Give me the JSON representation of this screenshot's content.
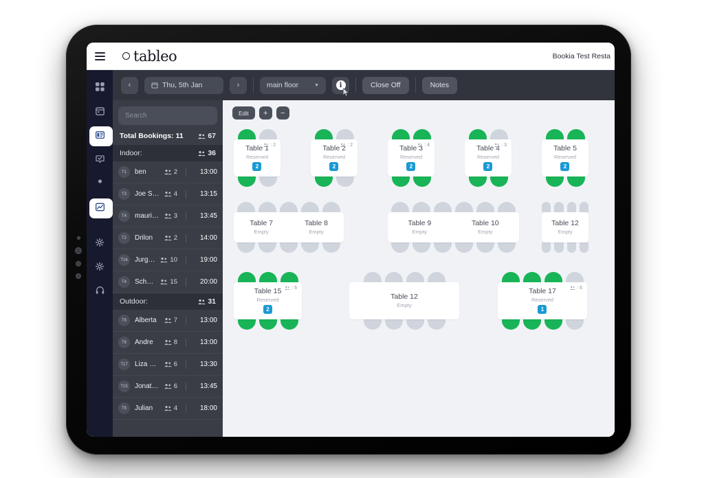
{
  "app": {
    "brand": "tableo",
    "restaurant": "Bookia Test Resta"
  },
  "rail": {
    "items": [
      {
        "icon": "dashboard-grid-icon",
        "active": false
      },
      {
        "icon": "calendar-icon",
        "active": false
      },
      {
        "icon": "table-layout-icon",
        "active": true
      },
      {
        "icon": "chat-bubble-icon",
        "active": false
      },
      {
        "icon": "person-icon",
        "active": false
      },
      {
        "icon": "chart-icon",
        "active": true
      },
      {
        "icon": "gear-icon",
        "active": false
      },
      {
        "icon": "gear-icon",
        "active": false
      },
      {
        "icon": "headset-icon",
        "active": false
      }
    ]
  },
  "toolbar": {
    "prev_label": "‹",
    "next_label": "›",
    "date": "Thu, 5th Jan",
    "floor": "main floor",
    "info_label": "i",
    "close_off": "Close Off",
    "notes": "Notes"
  },
  "sidebar": {
    "search_placeholder": "Search",
    "total_label": "Total Bookings: 11",
    "total_covers": "67",
    "groups": [
      {
        "label": "Indoor:",
        "covers": "36",
        "rows": [
          {
            "table": "T1",
            "name": "ben",
            "pax": "2",
            "time": "13:00",
            "stacked": false
          },
          {
            "table": "T3",
            "name": "Joe Sammut",
            "pax": "4",
            "time": "13:15",
            "stacked": false
          },
          {
            "table": "T4",
            "name": "mauricio suarez ...",
            "pax": "3",
            "time": "13:45",
            "stacked": false
          },
          {
            "table": "T2",
            "name": "Drilon",
            "pax": "2",
            "time": "14:00",
            "stacked": false
          },
          {
            "table": "T16",
            "name": "Jurgen",
            "pax": "10",
            "time": "19:00",
            "stacked": false
          },
          {
            "table": "T4",
            "name": "Schembri",
            "pax": "15",
            "time": "20:00",
            "stacked": true
          }
        ]
      },
      {
        "label": "Outdoor:",
        "covers": "31",
        "rows": [
          {
            "table": "T5",
            "name": "Alberta",
            "pax": "7",
            "time": "13:00",
            "stacked": false
          },
          {
            "table": "T6",
            "name": "Andre",
            "pax": "8",
            "time": "13:00",
            "stacked": false
          },
          {
            "table": "T17",
            "name": "Liza Lomax",
            "pax": "6",
            "time": "13:30",
            "stacked": false
          },
          {
            "table": "T15",
            "name": "Jonathan Azzopa...",
            "pax": "6",
            "time": "13:45",
            "stacked": false
          },
          {
            "table": "T5",
            "name": "Julian",
            "pax": "4",
            "time": "18:00",
            "stacked": false
          }
        ]
      }
    ]
  },
  "floor": {
    "actions": {
      "edit": "Edit",
      "plus": "+",
      "minus": "−"
    },
    "tables": [
      {
        "name": "Table 1",
        "state": "Reserved",
        "capacity": "2",
        "badge": "2",
        "seats_top": [
          1,
          0
        ],
        "seats_bottom": [
          1,
          0
        ]
      },
      {
        "name": "Table 2",
        "state": "Reserved",
        "capacity": "2",
        "badge": "2",
        "seats_top": [
          1,
          0
        ],
        "seats_bottom": [
          1,
          0
        ]
      },
      {
        "name": "Table 3",
        "state": "Reserved",
        "capacity": "4",
        "badge": "2",
        "seats_top": [
          1,
          1
        ],
        "seats_bottom": [
          1,
          1
        ]
      },
      {
        "name": "Table 4",
        "state": "Reserved",
        "capacity": "3",
        "badge": "2",
        "seats_top": [
          1,
          0
        ],
        "seats_bottom": [
          1,
          1
        ]
      },
      {
        "name": "Table 5",
        "state": "Reserved",
        "capacity": "",
        "badge": "2",
        "seats_top": [
          1,
          1
        ],
        "seats_bottom": [
          1,
          1
        ]
      },
      {
        "name": "Table 7",
        "state": "Empty",
        "capacity": "",
        "badge": "",
        "seats_top": [
          0,
          0,
          0,
          0,
          0
        ],
        "seats_bottom": [
          0,
          0,
          0,
          0,
          0
        ]
      },
      {
        "name": "Table 8",
        "state": "Empty",
        "capacity": "",
        "badge": "",
        "seats_top": [],
        "seats_bottom": []
      },
      {
        "name": "Table 9",
        "state": "Empty",
        "capacity": "",
        "badge": "",
        "seats_top": [
          0,
          0,
          0,
          0,
          0,
          0
        ],
        "seats_bottom": [
          0,
          0,
          0,
          0,
          0,
          0
        ]
      },
      {
        "name": "Table 10",
        "state": "Empty",
        "capacity": "",
        "badge": "",
        "seats_top": [],
        "seats_bottom": []
      },
      {
        "name": "Table 15",
        "state": "Reserved",
        "capacity": "6",
        "badge": "2",
        "seats_top": [
          1,
          1,
          1
        ],
        "seats_bottom": [
          1,
          1,
          1
        ]
      },
      {
        "name": "Table 12",
        "state": "Empty",
        "capacity": "",
        "badge": "",
        "seats_top": [
          0,
          0,
          0,
          0
        ],
        "seats_bottom": [
          0,
          0,
          0,
          0
        ]
      },
      {
        "name": "Table 17",
        "state": "Reserved",
        "capacity": "6",
        "badge": "1",
        "seats_top": [
          1,
          1,
          1,
          0
        ],
        "seats_bottom": [
          1,
          1,
          1,
          0
        ]
      }
    ]
  },
  "colors": {
    "seat_on": "#19b457",
    "seat_off": "#cfd4dd",
    "badge": "#1a9ad4",
    "rail_bg": "#171a2e",
    "toolbar_bg": "#31343d",
    "sidebar_bg": "#3a3d46"
  }
}
